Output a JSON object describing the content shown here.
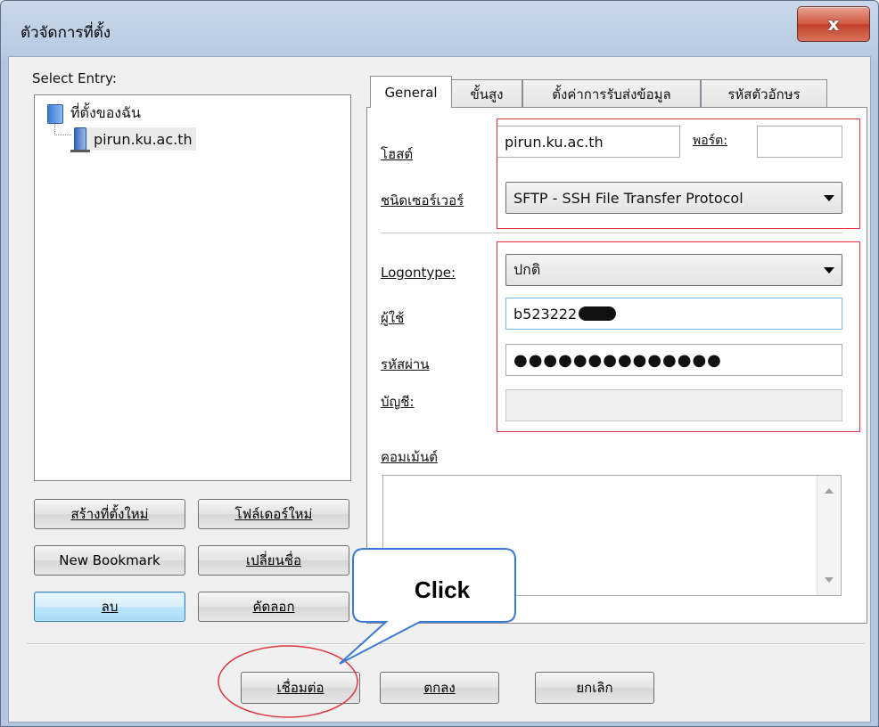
{
  "window": {
    "title": "ตัวจัดการที่ตั้ง",
    "close_glyph": "x"
  },
  "sidebar": {
    "select_label": "Select Entry:",
    "tree": [
      {
        "label": "ที่ตั้งของฉัน",
        "icon": "folder-icon"
      },
      {
        "label": "pirun.ku.ac.th",
        "icon": "server-icon"
      }
    ],
    "buttons": {
      "new_site": "สร้างที่ตั้งใหม่",
      "new_folder": "โฟล์เดอร์ใหม่",
      "new_bookmark": "New Bookmark",
      "rename": "เปลี่ยนชื่อ",
      "delete": "ลบ",
      "duplicate": "คัดลอก"
    }
  },
  "tabs": [
    "General",
    "ขั้นสูง",
    "ตั้งค่าการรับส่งข้อมูล",
    "รหัสตัวอักษร"
  ],
  "general": {
    "host_label": "โฮสต์",
    "host_value": "pirun.ku.ac.th",
    "port_label": "พอร์ต:",
    "port_value": "",
    "server_type_label": "ชนิดเซอร์เวอร์",
    "server_type_value": "SFTP - SSH File Transfer Protocol",
    "logontype_label": "Logontype:",
    "logontype_value": "ปกติ",
    "user_label": "ผู้ใช้",
    "user_value": "b523222",
    "password_label": "รหัสผ่าน",
    "password_value": "●●●●●●●●●●●●●●",
    "account_label": "บัญชี:",
    "account_value": "",
    "comment_label": "คอมเม้นต์"
  },
  "footer": {
    "connect": "เชื่อมต่อ",
    "ok": "ตกลง",
    "cancel": "ยกเลิก"
  },
  "annotation": {
    "callout_text": "Click",
    "highlight_color": "#e0343f",
    "callout_border_color": "#3b7ad6"
  }
}
